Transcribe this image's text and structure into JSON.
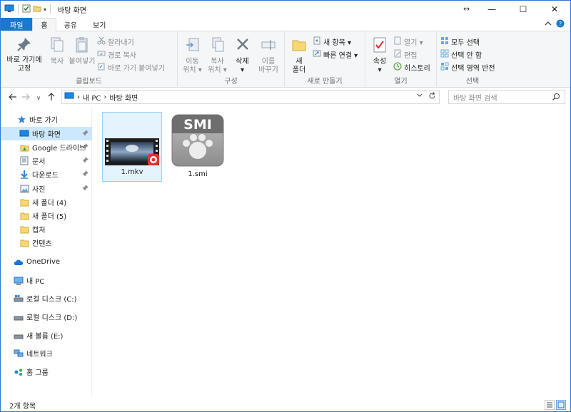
{
  "window": {
    "title": "바탕 화면",
    "resize_hint": "↔",
    "minimize": "—",
    "maximize": "☐",
    "close": "✕"
  },
  "tabs": [
    {
      "label": "파일"
    },
    {
      "label": "홈"
    },
    {
      "label": "공유"
    },
    {
      "label": "보기"
    }
  ],
  "ribbon": {
    "clipboard": {
      "label": "클립보드",
      "pin": "바로 가기에\n고정",
      "copy": "복사",
      "paste": "붙여넣기",
      "cut": "잘라내기",
      "copy_path": "경로 복사",
      "paste_shortcut": "바로 가기 붙여넣기"
    },
    "organize": {
      "label": "구성",
      "move_to": "이동\n위치 ▾",
      "copy_to": "복사\n위치 ▾",
      "delete": "삭제\n▾",
      "rename": "이름\n바꾸기"
    },
    "new": {
      "label": "새로 만들기",
      "new_folder": "새\n폴더",
      "new_item": "새 항목 ▾",
      "easy_access": "빠른 연결 ▾"
    },
    "open": {
      "label": "열기",
      "properties": "속성\n▾",
      "open": "열기 ▾",
      "edit": "편집",
      "history": "히스토리"
    },
    "select": {
      "label": "선택",
      "select_all": "모두 선택",
      "select_none": "선택 안 함",
      "invert": "선택 영역 반전"
    }
  },
  "address": {
    "crumbs": [
      "내 PC",
      "바탕 화면"
    ],
    "search_placeholder": "바탕 화면 검색"
  },
  "nav": {
    "items": [
      {
        "label": "바로 가기"
      },
      {
        "label": "바탕 화면"
      },
      {
        "label": "Google 드라이브"
      },
      {
        "label": "문서"
      },
      {
        "label": "다운로드"
      },
      {
        "label": "사진"
      },
      {
        "label": "새 폴더 (4)"
      },
      {
        "label": "새 폴더 (5)"
      },
      {
        "label": "캡처"
      },
      {
        "label": "컨텐츠"
      },
      {
        "label": "OneDrive"
      },
      {
        "label": "내 PC"
      },
      {
        "label": "로컬 디스크 (C:)"
      },
      {
        "label": "로컬 디스크 (D:)"
      },
      {
        "label": "새 볼륨 (E:)"
      },
      {
        "label": "네트워크"
      },
      {
        "label": "홈 그룹"
      }
    ]
  },
  "files": [
    {
      "name": "1.mkv"
    },
    {
      "name": "1.smi",
      "badge": "SMI"
    }
  ],
  "status": {
    "count": "2개 항목"
  },
  "colors": {
    "accent": "#1979ca",
    "selection": "#cce8ff",
    "folder": "#f8d775"
  }
}
